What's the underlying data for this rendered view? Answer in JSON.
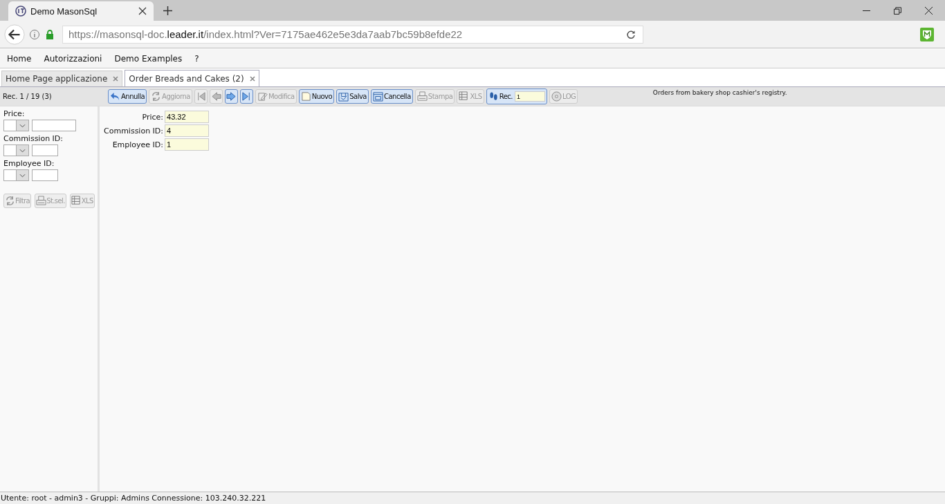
{
  "browser": {
    "tab_title": "Demo MasonSql",
    "url": {
      "prefix": "https://masonsql-doc.",
      "host": "leader.it",
      "suffix": "/index.html?Ver=7175ae462e5e3da7aab7bc59b8efde22"
    }
  },
  "menu": [
    "Home",
    "Autorizzazioni",
    "Demo Examples",
    "?"
  ],
  "tabs": [
    {
      "label": "Home Page applicazione",
      "selected": false
    },
    {
      "label": "Order Breads and Cakes (2)",
      "selected": true
    }
  ],
  "record_counter": "Rec. 1 / 19 (3)",
  "toolbar": [
    {
      "kind": "undo",
      "label": "Annulla",
      "disabled": false
    },
    {
      "kind": "refresh",
      "label": "Aggiorna",
      "disabled": true
    },
    {
      "kind": "first",
      "disabled": true
    },
    {
      "kind": "prev",
      "disabled": true
    },
    {
      "kind": "next",
      "disabled": false
    },
    {
      "kind": "last",
      "disabled": false
    },
    {
      "kind": "edit",
      "label": "Modifica",
      "disabled": true
    },
    {
      "kind": "new",
      "label": "Nuovo",
      "disabled": false
    },
    {
      "kind": "save",
      "label": "Salva",
      "disabled": false
    },
    {
      "kind": "delete",
      "label": "Cancella",
      "disabled": false
    },
    {
      "kind": "print",
      "label": "Stampa",
      "disabled": true
    },
    {
      "kind": "xls",
      "label": "XLS",
      "disabled": true
    },
    {
      "kind": "rec",
      "label": "Rec.",
      "value": "1",
      "disabled": false
    },
    {
      "kind": "disc",
      "label": "LOG",
      "disabled": true
    }
  ],
  "description": "Orders from bakery shop cashier's registry.",
  "filters": [
    {
      "label": "Price:"
    },
    {
      "label": "Commission ID:"
    },
    {
      "label": "Employee ID:"
    }
  ],
  "filter_buttons": [
    {
      "kind": "refresh",
      "label": "Filtra"
    },
    {
      "kind": "print",
      "label": "St.sel."
    },
    {
      "kind": "xls",
      "label": "XLS"
    }
  ],
  "form": [
    {
      "label": "Price:",
      "value": "43.32"
    },
    {
      "label": "Commission ID:",
      "value": "4"
    },
    {
      "label": "Employee ID:",
      "value": "1"
    }
  ],
  "status_bar": "Utente: root - admin3 - Gruppi: Admins Connessione: 103.240.32.221"
}
